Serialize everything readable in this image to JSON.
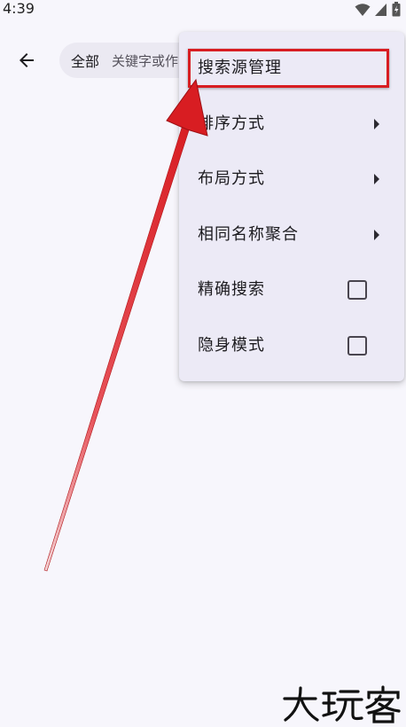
{
  "status_bar": {
    "time": "4:39",
    "icons": [
      "wifi-icon",
      "signal-icon",
      "battery-icon"
    ]
  },
  "toolbar": {
    "back_icon": "arrow-left-icon",
    "search_scope": "全部",
    "search_placeholder": "关键字或作"
  },
  "menu": {
    "items": [
      {
        "label": "搜索源管理",
        "kind": "action"
      },
      {
        "label": "排序方式",
        "kind": "submenu"
      },
      {
        "label": "布局方式",
        "kind": "submenu"
      },
      {
        "label": "相同名称聚合",
        "kind": "submenu"
      },
      {
        "label": "精确搜索",
        "kind": "checkbox",
        "checked": false
      },
      {
        "label": "隐身模式",
        "kind": "checkbox",
        "checked": false
      }
    ]
  },
  "annotation": {
    "highlight_color": "#d81d22"
  },
  "watermark": {
    "text": "大玩客"
  },
  "colors": {
    "background": "#f7f6fc",
    "menu_background": "#eceaf6",
    "search_chip": "#ebe9f2"
  }
}
